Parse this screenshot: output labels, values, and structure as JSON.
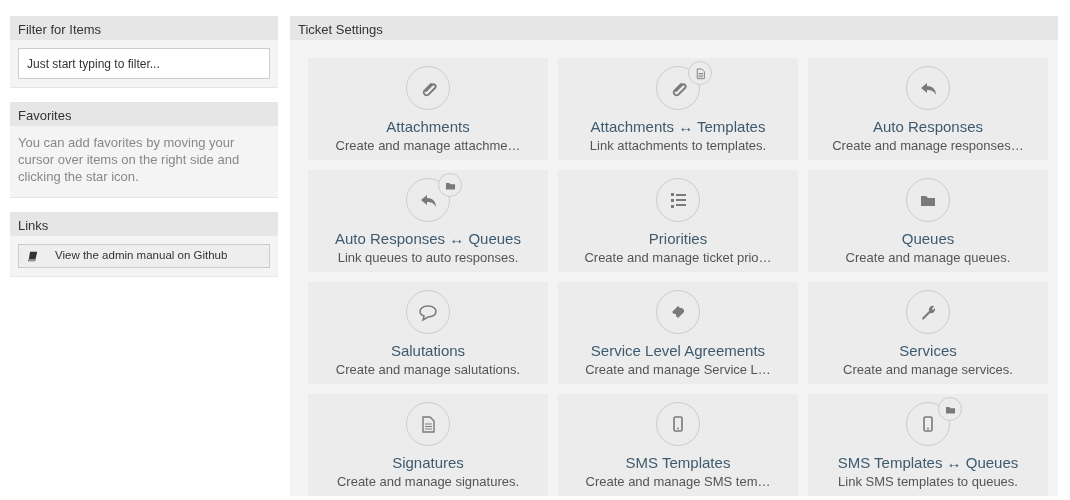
{
  "sidebar": {
    "filter": {
      "title": "Filter for Items",
      "placeholder": "Just start typing to filter..."
    },
    "favorites": {
      "title": "Favorites",
      "text": "You can add favorites by moving your cursor over items on the right side and clicking the star icon."
    },
    "links": {
      "title": "Links",
      "items": [
        {
          "label": "View the admin manual on Github"
        }
      ]
    }
  },
  "panel": {
    "title": "Ticket Settings",
    "tiles": [
      {
        "title": "Attachments",
        "description": "Create and manage attachme…"
      },
      {
        "title": "Attachments ↔ Templates",
        "description": "Link attachments to templates."
      },
      {
        "title": "Auto Responses",
        "description": "Create and manage responses…"
      },
      {
        "title": "Auto Responses ↔ Queues",
        "description": "Link queues to auto responses."
      },
      {
        "title": "Priorities",
        "description": "Create and manage ticket prio…"
      },
      {
        "title": "Queues",
        "description": "Create and manage queues."
      },
      {
        "title": "Salutations",
        "description": "Create and manage salutations."
      },
      {
        "title": "Service Level Agreements",
        "description": "Create and manage Service L…"
      },
      {
        "title": "Services",
        "description": "Create and manage services."
      },
      {
        "title": "Signatures",
        "description": "Create and manage signatures."
      },
      {
        "title": "SMS Templates",
        "description": "Create and manage SMS tem…"
      },
      {
        "title": "SMS Templates ↔ Queues",
        "description": "Link SMS templates to queues."
      }
    ]
  }
}
